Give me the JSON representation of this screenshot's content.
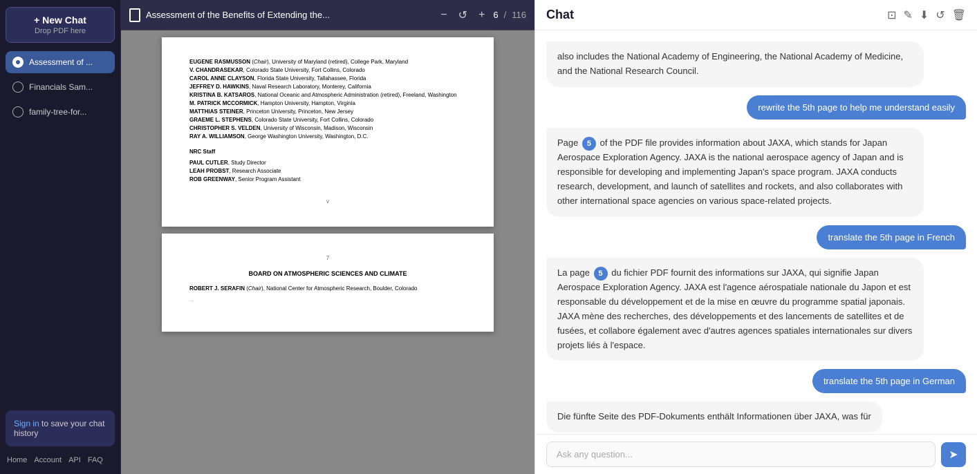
{
  "sidebar": {
    "new_chat_label": "+ New Chat",
    "drop_label": "Drop PDF here",
    "items": [
      {
        "id": "assessment",
        "label": "Assessment of ...",
        "active": true
      },
      {
        "id": "financials",
        "label": "Financials Sam...",
        "active": false
      },
      {
        "id": "family-tree",
        "label": "family-tree-for...",
        "active": false
      }
    ],
    "sign_in_text": " to save your chat history",
    "sign_in_link": "Sign in",
    "footer": {
      "home": "Home",
      "account": "Account",
      "api": "API",
      "faq": "FAQ"
    }
  },
  "pdf": {
    "title": "Assessment of the Benefits of Extending the...",
    "current_page": "6",
    "total_pages": "116",
    "page6": {
      "members": [
        {
          "name": "EUGENE RASMUSSON",
          "role": "Chair",
          "affil": "University of Maryland (retired), College Park, Maryland"
        },
        {
          "name": "V. CHANDRASEKAR",
          "affil": "Colorado State University, Fort Collins, Colorado"
        },
        {
          "name": "CAROL ANNE CLAYSON",
          "affil": "Florida State University, Tallahassee, Florida"
        },
        {
          "name": "JEFFREY D. HAWKINS",
          "affil": "Naval Research Laboratory, Monterey, California"
        },
        {
          "name": "KRISTINA B. KATSAROS",
          "affil": "National Oceanic and Atmospheric Administration (retired), Freeland, Washington"
        },
        {
          "name": "M. PATRICK MCCORMICK",
          "affil": "Hampton University, Hampton, Virginia"
        },
        {
          "name": "MATTHIAS STEINER",
          "affil": "Princeton University, Princeton, New Jersey"
        },
        {
          "name": "GRAEME L. STEPHENS",
          "affil": "Colorado State University, Fort Collins, Colorado"
        },
        {
          "name": "CHRISTOPHER S. VELDEN",
          "affil": "University of Wisconsin, Madison, Wisconsin"
        },
        {
          "name": "RAY A. WILLIAMSON",
          "affil": "George Washington University, Washington, D.C."
        }
      ],
      "nrc_staff_label": "NRC Staff",
      "nrc_staff": [
        {
          "name": "PAUL CUTLER",
          "role": "Study Director"
        },
        {
          "name": "LEAH PROBST",
          "role": "Research Associate"
        },
        {
          "name": "ROB GREENWAY",
          "role": "Senior Program Assistant"
        }
      ],
      "footer": "v"
    },
    "page7": {
      "page_label": "7",
      "title": "BOARD ON ATMOSPHERIC SCIENCES AND CLIMATE",
      "members": [
        {
          "name": "ROBERT J. SERAFIN",
          "role": "Chair",
          "affil": "National Center for Atmospheric Research, Boulder, Colorado"
        }
      ]
    }
  },
  "chat": {
    "title": "Chat",
    "icons": {
      "external": "⊡",
      "edit": "✎",
      "download": "⬇",
      "refresh": "↺",
      "trash": "🗑"
    },
    "messages": [
      {
        "type": "context",
        "text": "also includes the National Academy of Engineering, the National Academy of Medicine, and the National Research Council."
      },
      {
        "type": "user",
        "text": "rewrite the 5th page to help me understand easily"
      },
      {
        "type": "ai",
        "page_badge": "5",
        "text_before": "Page ",
        "text_after": " of the PDF file provides information about JAXA, which stands for Japan Aerospace Exploration Agency. JAXA is the national aerospace agency of Japan and is responsible for developing and implementing Japan's space program. JAXA conducts research, development, and launch of satellites and rockets, and also collaborates with other international space agencies on various space-related projects."
      },
      {
        "type": "user",
        "text": "translate the 5th page in French"
      },
      {
        "type": "ai",
        "page_badge": "5",
        "text_before": "La page ",
        "text_after": " du fichier PDF fournit des informations sur JAXA, qui signifie Japan Aerospace Exploration Agency. JAXA est l'agence aérospatiale nationale du Japon et est responsable du développement et de la mise en œuvre du programme spatial japonais. JAXA mène des recherches, des développements et des lancements de satellites et de fusées, et collabore également avec d'autres agences spatiales internationales sur divers projets liés à l'espace."
      },
      {
        "type": "user",
        "text": "translate the 5th page in German"
      },
      {
        "type": "ai_partial",
        "text": "Die fünfte Seite des PDF-Dokuments enthält Informationen über JAXA, was für"
      }
    ],
    "input_placeholder": "Ask any question...",
    "send_icon": "➤"
  }
}
